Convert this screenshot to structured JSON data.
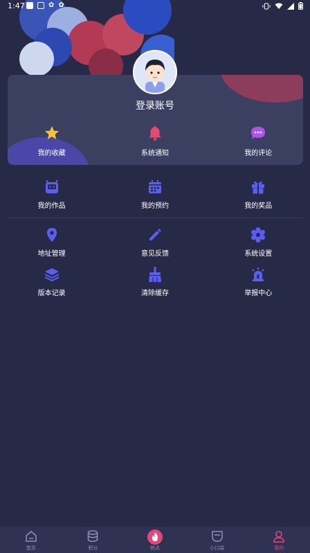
{
  "status_bar": {
    "time": "1:47"
  },
  "profile": {
    "login_label": "登录账号"
  },
  "quick_actions": [
    {
      "label": "我的收藏",
      "icon": "star-icon",
      "color": "#f5c23a"
    },
    {
      "label": "系统通知",
      "icon": "bell-icon",
      "color": "#e84a6e"
    },
    {
      "label": "我的评论",
      "icon": "comment-icon",
      "color": "#b054e8"
    }
  ],
  "menu_row1": [
    {
      "label": "我的作品",
      "icon": "robot-icon"
    },
    {
      "label": "我的预约",
      "icon": "calendar-icon"
    },
    {
      "label": "我的奖品",
      "icon": "gift-icon"
    }
  ],
  "menu_row2": [
    {
      "label": "地址管理",
      "icon": "location-icon"
    },
    {
      "label": "意见反馈",
      "icon": "pencil-icon"
    },
    {
      "label": "系统设置",
      "icon": "gear-icon"
    }
  ],
  "menu_row3": [
    {
      "label": "版本记录",
      "icon": "layers-icon"
    },
    {
      "label": "清除缓存",
      "icon": "broom-icon"
    },
    {
      "label": "举报中心",
      "icon": "siren-icon"
    }
  ],
  "bottom_nav": [
    {
      "label": "首页",
      "icon": "home-icon"
    },
    {
      "label": "积分",
      "icon": "database-icon"
    },
    {
      "label": "热点",
      "icon": "fire-icon"
    },
    {
      "label": "小口袋",
      "icon": "pocket-icon"
    },
    {
      "label": "我的",
      "icon": "user-icon",
      "active": true
    }
  ],
  "colors": {
    "accent": "#5a5ef5",
    "active": "#e0487a",
    "background": "#272a46"
  }
}
